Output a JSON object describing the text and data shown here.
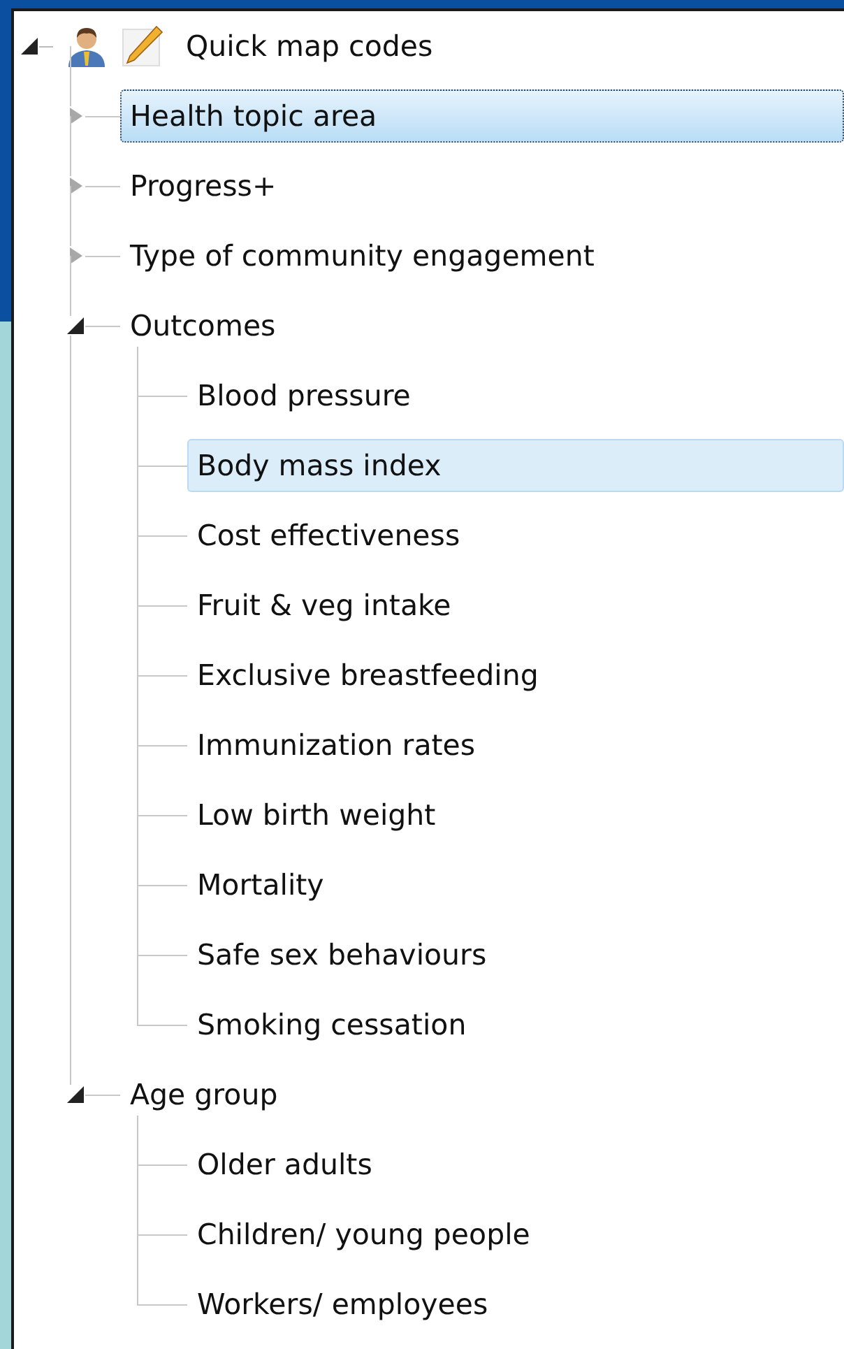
{
  "tree": {
    "label": "Quick map codes",
    "expanded": true,
    "children": [
      {
        "label": "Health topic area",
        "selected": true,
        "expanded": false
      },
      {
        "label": "Progress+",
        "selected": false,
        "expanded": false
      },
      {
        "label": "Type of community engagement",
        "selected": false,
        "expanded": false
      },
      {
        "label": "Outcomes",
        "selected": false,
        "expanded": true,
        "children": [
          {
            "label": "Blood pressure",
            "selected": false,
            "hovered": false
          },
          {
            "label": "Body mass index",
            "selected": false,
            "hovered": true
          },
          {
            "label": "Cost effectiveness",
            "selected": false,
            "hovered": false
          },
          {
            "label": "Fruit & veg intake",
            "selected": false,
            "hovered": false
          },
          {
            "label": "Exclusive breastfeeding",
            "selected": false,
            "hovered": false
          },
          {
            "label": "Immunization rates",
            "selected": false,
            "hovered": false
          },
          {
            "label": "Low birth weight",
            "selected": false,
            "hovered": false
          },
          {
            "label": "Mortality",
            "selected": false,
            "hovered": false
          },
          {
            "label": "Safe sex behaviours",
            "selected": false,
            "hovered": false
          },
          {
            "label": "Smoking cessation",
            "selected": false,
            "hovered": false
          }
        ]
      },
      {
        "label": "Age group",
        "selected": false,
        "expanded": true,
        "children": [
          {
            "label": "Older adults",
            "selected": false,
            "hovered": false
          },
          {
            "label": "Children/ young people",
            "selected": false,
            "hovered": false
          },
          {
            "label": "Workers/ employees",
            "selected": false,
            "hovered": false
          }
        ]
      }
    ]
  }
}
